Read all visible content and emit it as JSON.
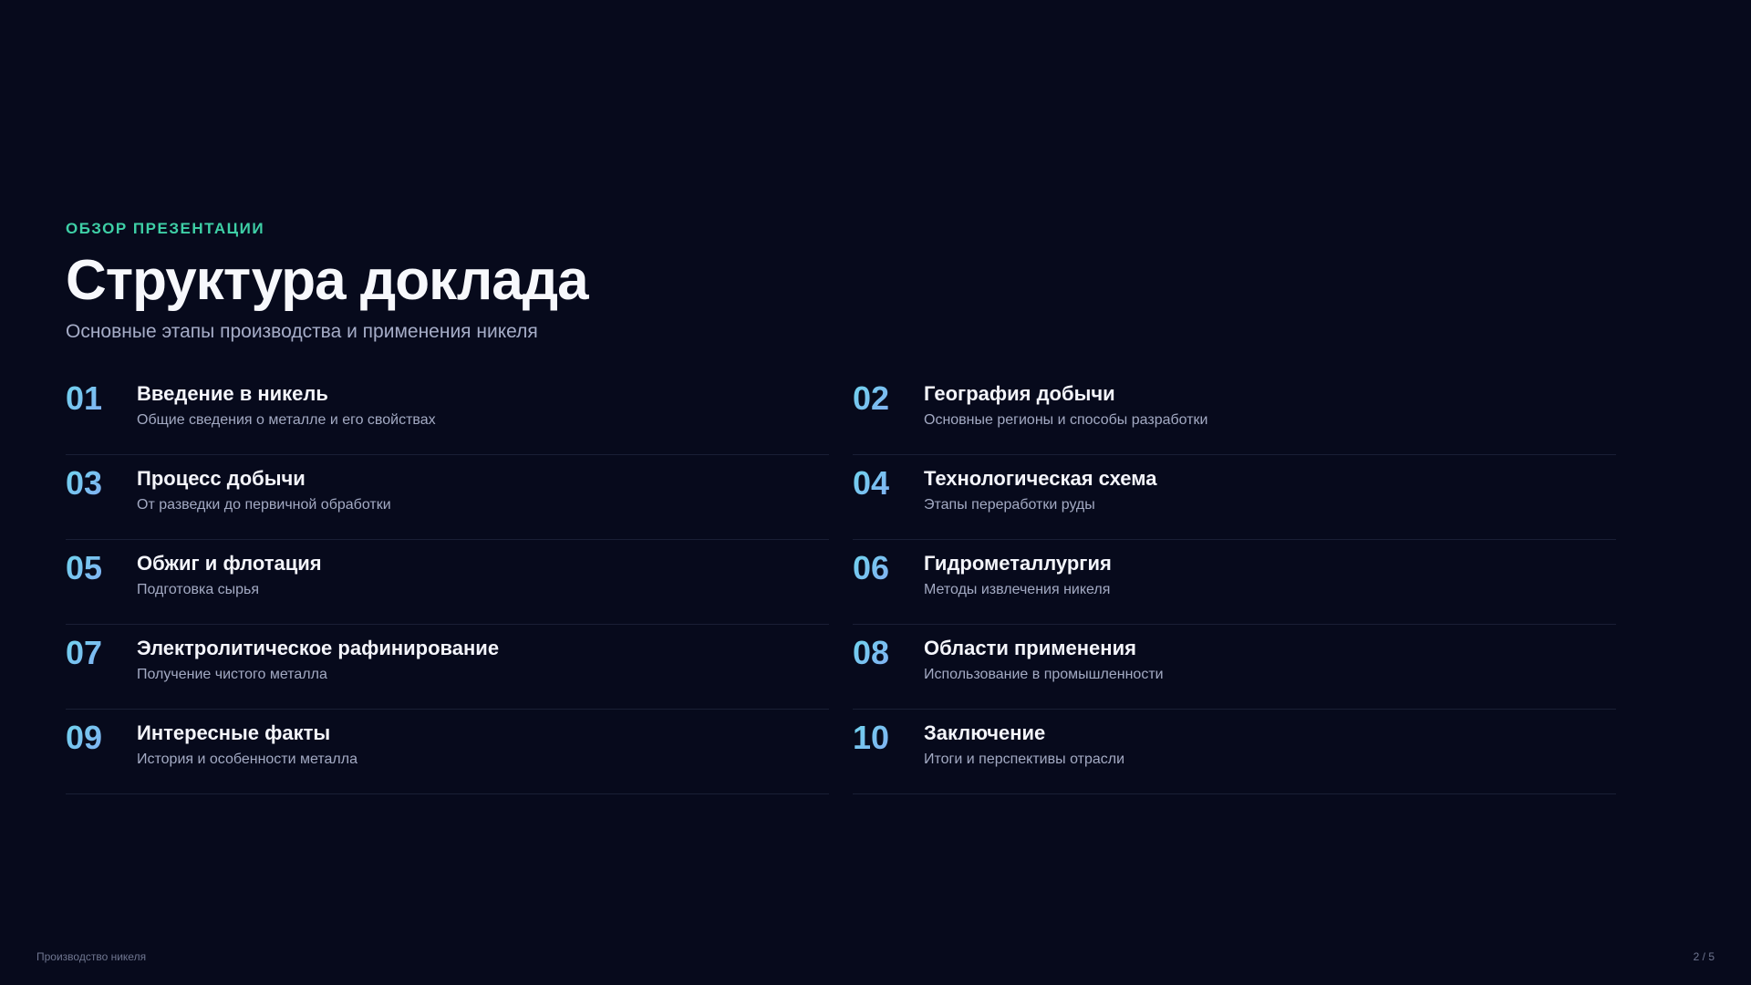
{
  "header": {
    "eyebrow": "ОБЗОР ПРЕЗЕНТАЦИИ",
    "title": "Структура доклада",
    "subtitle": "Основные этапы производства и применения никеля"
  },
  "items": [
    {
      "num": "01",
      "title": "Введение в никель",
      "desc": "Общие сведения о металле и его свойствах"
    },
    {
      "num": "02",
      "title": "География добычи",
      "desc": "Основные регионы и способы разработки"
    },
    {
      "num": "03",
      "title": "Процесс добычи",
      "desc": "От разведки до первичной обработки"
    },
    {
      "num": "04",
      "title": "Технологическая схема",
      "desc": "Этапы переработки руды"
    },
    {
      "num": "05",
      "title": "Обжиг и флотация",
      "desc": "Подготовка сырья"
    },
    {
      "num": "06",
      "title": "Гидрометаллургия",
      "desc": "Методы извлечения никеля"
    },
    {
      "num": "07",
      "title": "Электролитическое рафинирование",
      "desc": "Получение чистого металла"
    },
    {
      "num": "08",
      "title": "Области применения",
      "desc": "Использование в промышленности"
    },
    {
      "num": "09",
      "title": "Интересные факты",
      "desc": "История и особенности металла"
    },
    {
      "num": "10",
      "title": "Заключение",
      "desc": "Итоги и перспективы отрасли"
    }
  ],
  "footer": {
    "left": "Производство никеля",
    "page": "2 / 5"
  },
  "colors": {
    "background": "#070a1c",
    "accent": "#3ecfa6",
    "number_gradient_start": "#6fd6ee",
    "number_gradient_end": "#8b9cf5"
  }
}
